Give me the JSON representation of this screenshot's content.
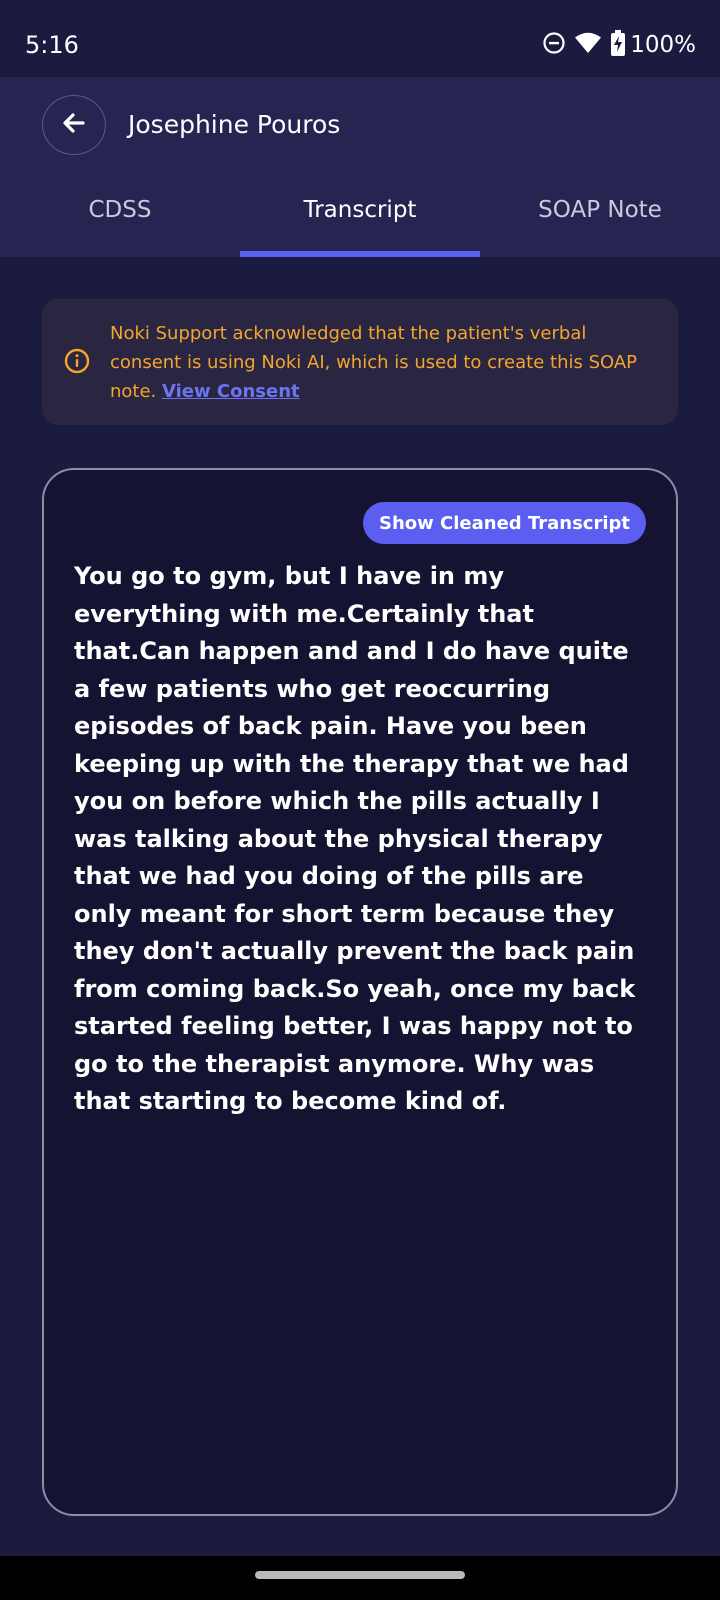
{
  "status_bar": {
    "time": "5:16",
    "battery": "100%",
    "icons": [
      "do-not-disturb-icon",
      "wifi-icon",
      "battery-charging-icon"
    ]
  },
  "header": {
    "back_icon": "arrow-left-icon",
    "patient_name": "Josephine Pouros"
  },
  "tabs": [
    {
      "label": "CDSS",
      "active": false
    },
    {
      "label": "Transcript",
      "active": true
    },
    {
      "label": "SOAP Note",
      "active": false
    }
  ],
  "consent": {
    "icon": "info-circle-icon",
    "text": "Noki Support acknowledged that the patient's verbal consent is using Noki AI, which is used to create this SOAP note. ",
    "link_label": "View Consent"
  },
  "transcript": {
    "button_label": "Show Cleaned Transcript",
    "text": "You go to gym, but I have in my everything with me.Certainly that that.Can happen and and I do have quite a few patients who get reoccurring episodes of back pain. Have you been keeping up with the therapy that we had you on before which the pills actually I was talking about the physical therapy that we had you doing of the pills are only meant for short term because they they don't actually prevent the back pain from coming back.So yeah, once my back started feeling better, I was happy not to go to the therapist anymore. Why was that starting to become kind of."
  },
  "colors": {
    "background": "#1b1b3f",
    "header": "#262552",
    "accent": "#5b5ef0",
    "warning": "#f3a62d"
  }
}
